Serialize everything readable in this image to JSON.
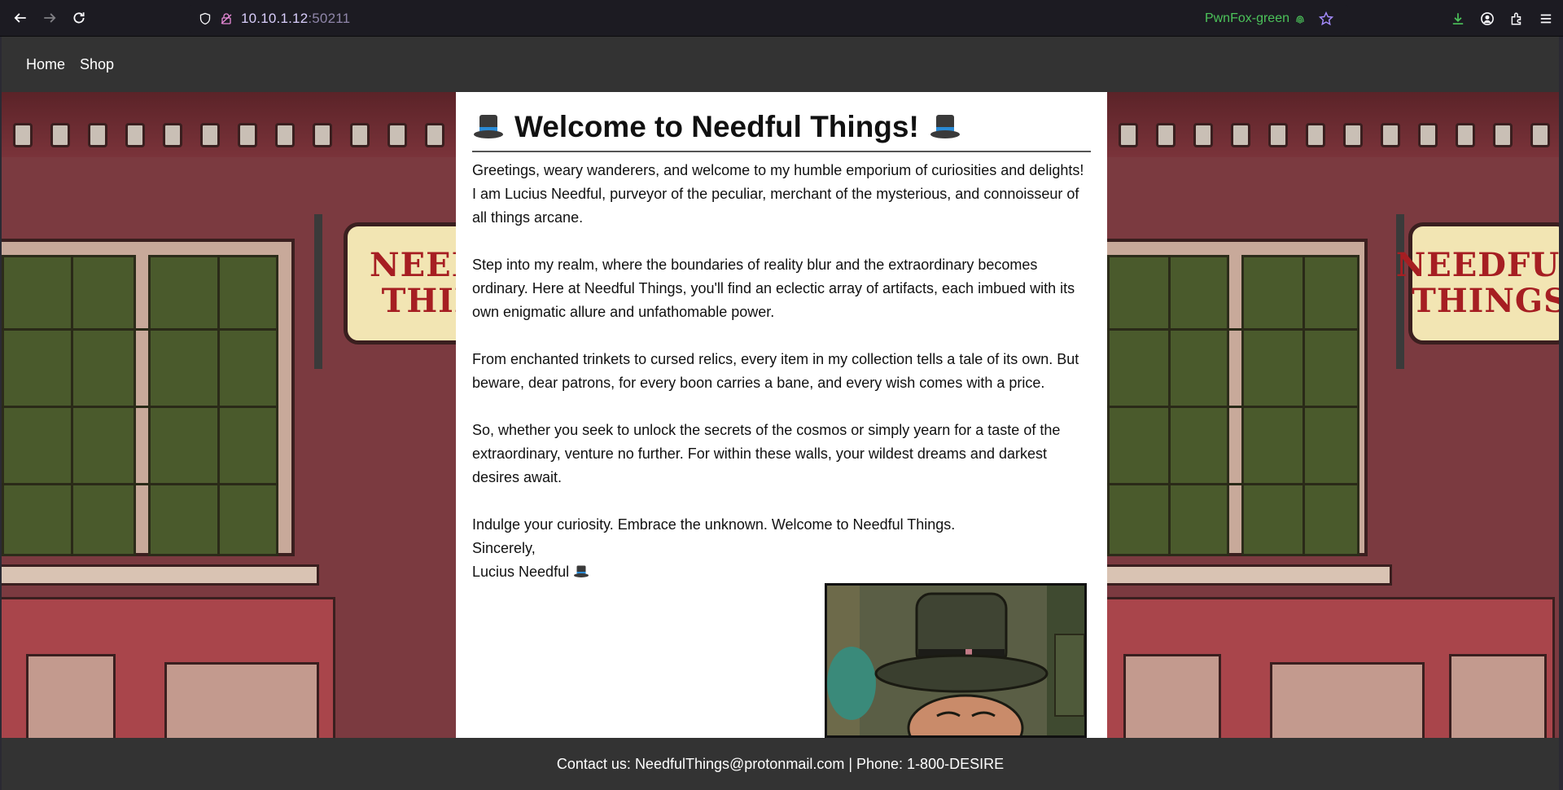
{
  "browser": {
    "url_host": "10.10.1.12",
    "url_port": ":50211",
    "container_label": "PwnFox-green"
  },
  "site_nav": {
    "items": [
      {
        "label": "Home"
      },
      {
        "label": "Shop"
      }
    ]
  },
  "scene": {
    "sign_text_left": "NEEDI THIN",
    "sign_text_right_line1": "NEEDFUL",
    "sign_text_right_line2": "THINGS"
  },
  "content": {
    "title": "Welcome to Needful Things!",
    "paragraphs": [
      "Greetings, weary wanderers, and welcome to my humble emporium of curiosities and delights! I am Lucius Needful, purveyor of the peculiar, merchant of the mysterious, and connoisseur of all things arcane.",
      "Step into my realm, where the boundaries of reality blur and the extraordinary becomes ordinary. Here at Needful Things, you'll find an eclectic array of artifacts, each imbued with its own enigmatic allure and unfathomable power.",
      "From enchanted trinkets to cursed relics, every item in my collection tells a tale of its own. But beware, dear patrons, for every boon carries a bane, and every wish comes with a price.",
      "So, whether you seek to unlock the secrets of the cosmos or simply yearn for a taste of the extraordinary, venture no further. For within these walls, your wildest dreams and darkest desires await.",
      "Indulge your curiosity. Embrace the unknown. Welcome to Needful Things."
    ],
    "closing": "Sincerely,",
    "signature": "Lucius Needful"
  },
  "footer": {
    "text": "Contact us: NeedfulThings@protonmail.com | Phone: 1-800-DESIRE"
  },
  "colors": {
    "nav_bg": "#333333",
    "accent_green": "#4cc35a",
    "url_purple": "#c6b4ff"
  }
}
